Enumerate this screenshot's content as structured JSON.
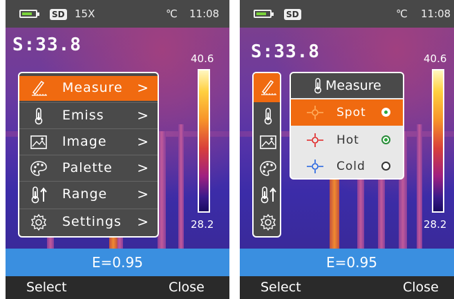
{
  "left": {
    "status": {
      "sd": "SD",
      "zoom": "15X",
      "unit": "℃",
      "time": "11:08"
    },
    "spot_value": "S:33.8",
    "scale": {
      "max": "40.6",
      "min": "28.2"
    },
    "emissivity": "E=0.95",
    "softkeys": {
      "left": "Select",
      "right": "Close"
    },
    "menu": [
      {
        "label": "Measure",
        "icon": "ruler-pencil-icon",
        "selected": true
      },
      {
        "label": "Emiss",
        "icon": "thermometer-icon"
      },
      {
        "label": "Image",
        "icon": "image-icon"
      },
      {
        "label": "Palette",
        "icon": "palette-icon"
      },
      {
        "label": "Range",
        "icon": "range-thermometer-icon"
      },
      {
        "label": "Settings",
        "icon": "gear-icon"
      }
    ]
  },
  "right": {
    "status": {
      "sd": "SD",
      "unit": "℃",
      "time": "11:08"
    },
    "spot_value": "S:33.8",
    "scale": {
      "max": "40.6",
      "min": "28.2"
    },
    "emissivity": "E=0.95",
    "softkeys": {
      "left": "Select",
      "right": "Close"
    },
    "submenu": {
      "title": "Measure",
      "items": [
        {
          "label": "Spot",
          "icon": "crosshair-orange-icon",
          "selected": true,
          "checked": true
        },
        {
          "label": "Hot",
          "icon": "crosshair-red-icon",
          "checked": true
        },
        {
          "label": "Cold",
          "icon": "crosshair-blue-icon",
          "checked": false
        }
      ]
    }
  },
  "colors": {
    "accent": "#f06a10",
    "ebar": "#3a8fe0",
    "menu_bg": "#4a4a4a"
  }
}
